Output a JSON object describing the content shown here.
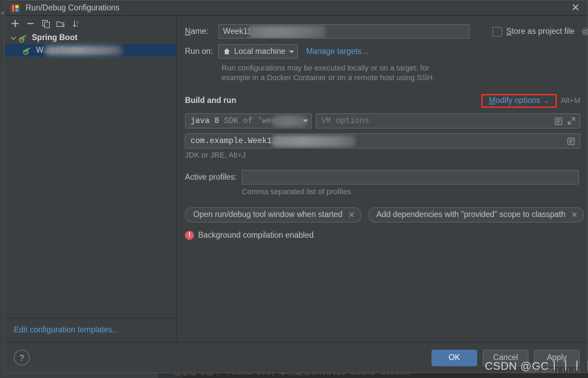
{
  "window": {
    "title": "Run/Debug Configurations",
    "close_label": "✕",
    "app_icon": "intellij-idea-icon"
  },
  "sidebar": {
    "toolbar": [
      {
        "name": "add-configuration-button",
        "icon": "plus-icon",
        "label": "+"
      },
      {
        "name": "remove-configuration-button",
        "icon": "minus-icon",
        "label": "−"
      },
      {
        "name": "copy-configuration-button",
        "icon": "copy-icon",
        "label": "copy"
      },
      {
        "name": "save-configuration-button",
        "icon": "folder-arrow-icon",
        "label": "save"
      },
      {
        "name": "sort-configurations-button",
        "icon": "sort-az-icon",
        "label": "sort"
      }
    ],
    "tree": [
      {
        "label": "Spring Boot",
        "expanded": true,
        "icon": "spring-boot-icon",
        "selected": false,
        "level": 0
      },
      {
        "label": "W…pplication",
        "expanded": false,
        "icon": "spring-boot-icon",
        "selected": true,
        "level": 1,
        "redacted": true
      }
    ],
    "edit_templates_link": "Edit configuration templates..."
  },
  "form": {
    "name_label": "Name:",
    "name_label_mnemonic": "N",
    "name_value": "Week11…pplication",
    "name_value_prefix": "Week11",
    "name_value_suffix": "pplication",
    "store_as_project_file_label": "Store as project file",
    "store_as_project_file_checked": false,
    "store_gear_icon": "gear-icon",
    "run_on_label": "Run on:",
    "run_on_value": "Local machine",
    "run_on_icon": "home-icon",
    "manage_targets_link": "Manage targets...",
    "run_on_hint": "Run configurations may be executed locally or on a target: for example in a Docker Container or on a remote host using SSH."
  },
  "build_and_run": {
    "section_title": "Build and run",
    "modify_options_label": "Modify options",
    "modify_options_mnemonic": "M",
    "modify_options_chevron": "⌄",
    "modify_options_shortcut": "Alt+M",
    "sdk_value": "java 8 SDK of 'week11_…'",
    "sdk_value_bold": "java 8",
    "sdk_value_rest": " SDK of 'week11_…",
    "vm_options_placeholder": "VM options",
    "vm_expand_icon": "expand-diagonal-icon",
    "vm_list_icon": "list-icon",
    "main_class_value": "com.example.Week1…lication",
    "main_class_prefix": "com.example.Week1",
    "main_class_suffix": "lication",
    "main_class_list_icon": "list-icon",
    "jdk_hint": "JDK or JRE, Alt+J"
  },
  "profiles": {
    "label": "Active profiles:",
    "value": "",
    "hint": "Comma separated list of profiles"
  },
  "chips": [
    {
      "label": "Open run/debug tool window when started",
      "close": "✕"
    },
    {
      "label": "Add dependencies with \"provided\" scope to classpath",
      "close": "✕"
    }
  ],
  "warning": {
    "icon": "error-exclamation-icon",
    "text": "Background compilation enabled"
  },
  "footer": {
    "help_label": "?",
    "help_icon": "question-mark-icon",
    "ok_label": "OK",
    "cancel_label": "Cancel",
    "apply_label": "Apply"
  },
  "background": {
    "editor_line": "注意是与这个 resources，本次是添Invalid bound statem",
    "left_edge_label": "el"
  },
  "watermark": {
    "text": "CSDN @GC丨丨丨丨丨",
    "subtext": "CSDN @GC丨丨丨丨丨"
  },
  "colors": {
    "dialog_bg": "#3c3f41",
    "field_bg": "#45494a",
    "accent_link": "#5a9ed6",
    "selection_bg": "#1d3a5f",
    "ok_button": "#4a76a8",
    "annotation_red": "#e8342a",
    "warning_red": "#db5860"
  }
}
